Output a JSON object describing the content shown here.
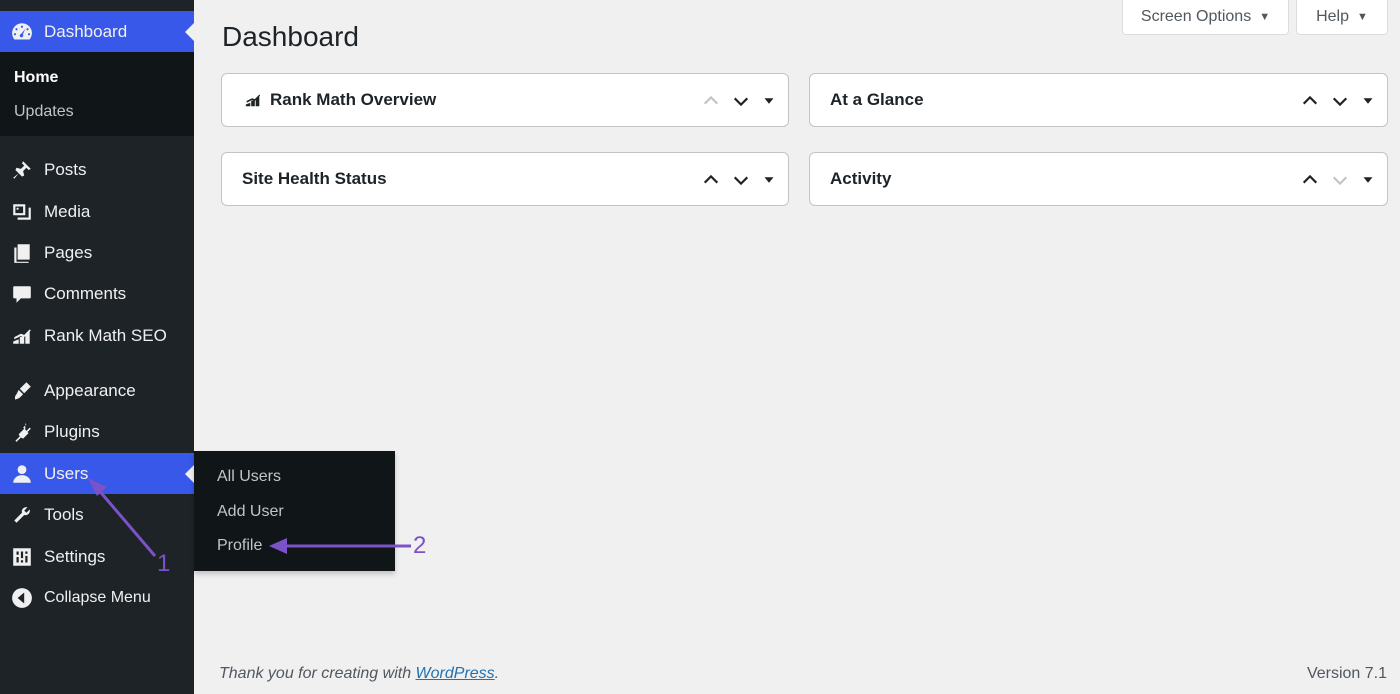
{
  "sidebar": {
    "dashboard": {
      "label": "Dashboard",
      "icon": "dashboard-icon"
    },
    "dashboard_sub": [
      {
        "label": "Home",
        "current": true
      },
      {
        "label": "Updates",
        "current": false
      }
    ],
    "items": [
      {
        "label": "Posts",
        "icon": "pin-icon"
      },
      {
        "label": "Media",
        "icon": "media-icon"
      },
      {
        "label": "Pages",
        "icon": "pages-icon"
      },
      {
        "label": "Comments",
        "icon": "comments-icon"
      },
      {
        "label": "Rank Math SEO",
        "icon": "rank-math-icon"
      },
      {
        "label": "Appearance",
        "icon": "appearance-icon"
      },
      {
        "label": "Plugins",
        "icon": "plugins-icon"
      },
      {
        "label": "Users",
        "icon": "users-icon"
      },
      {
        "label": "Tools",
        "icon": "tools-icon"
      },
      {
        "label": "Settings",
        "icon": "settings-icon"
      },
      {
        "label": "Collapse Menu",
        "icon": "collapse-icon"
      }
    ]
  },
  "users_flyout": [
    "All Users",
    "Add User",
    "Profile"
  ],
  "header": {
    "title": "Dashboard",
    "screen_options": "Screen Options",
    "help": "Help"
  },
  "widgets": [
    {
      "title": "Rank Math Overview"
    },
    {
      "title": "At a Glance"
    },
    {
      "title": "Site Health Status"
    },
    {
      "title": "Activity"
    }
  ],
  "footer": {
    "thanks_prefix": "Thank you for creating with ",
    "thanks_link": "WordPress",
    "thanks_suffix": ".",
    "version": "Version 7.1"
  },
  "annotations": {
    "one": "1",
    "two": "2"
  },
  "colors": {
    "sidebar": "#1d2327",
    "accent": "#3858e9",
    "annotation": "#7b52c7"
  }
}
